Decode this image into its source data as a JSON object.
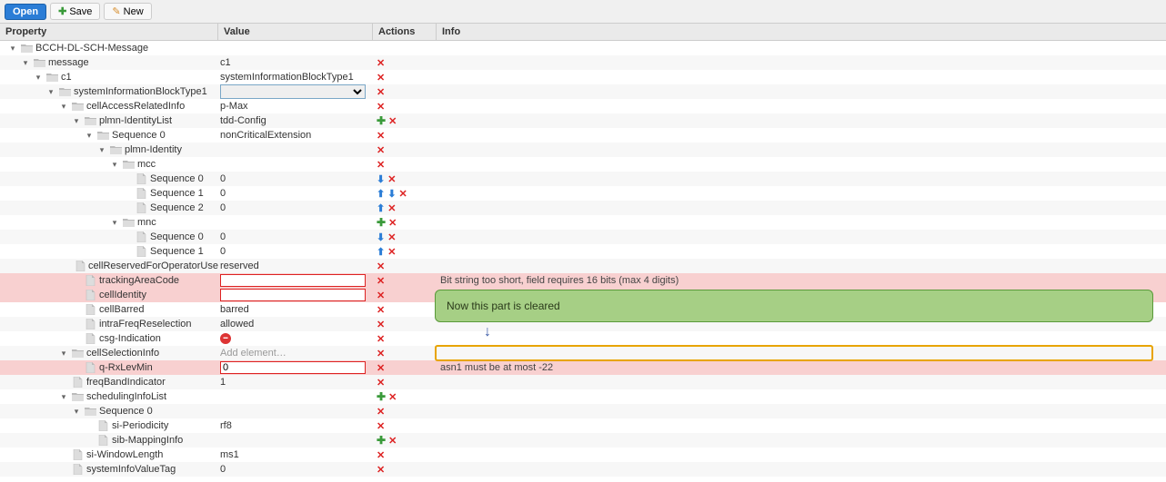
{
  "toolbar": {
    "open": "Open",
    "save": "Save",
    "new": "New"
  },
  "columns": {
    "property": "Property",
    "value": "Value",
    "actions": "Actions",
    "info": "Info"
  },
  "callout": {
    "text": "Now this part is cleared"
  },
  "rows": [
    {
      "depth": 0,
      "toggle": "▾",
      "icon": "folder",
      "label": "BCCH-DL-SCH-Message",
      "value": "",
      "actions": [],
      "info": ""
    },
    {
      "depth": 1,
      "toggle": "▾",
      "icon": "folder",
      "label": "message",
      "value": "c1",
      "actions": [
        "x"
      ],
      "info": ""
    },
    {
      "depth": 2,
      "toggle": "▾",
      "icon": "folder",
      "label": "c1",
      "value": "systemInformationBlockType1",
      "actions": [
        "x"
      ],
      "info": ""
    },
    {
      "depth": 3,
      "toggle": "▾",
      "icon": "folder",
      "label": "systemInformationBlockType1",
      "value": "",
      "valueSelect": true,
      "actions": [
        "x"
      ],
      "info": ""
    },
    {
      "depth": 4,
      "toggle": "▾",
      "icon": "folder",
      "label": "cellAccessRelatedInfo",
      "value": "p-Max",
      "actions": [
        "x"
      ],
      "info": ""
    },
    {
      "depth": 5,
      "toggle": "▾",
      "icon": "folder",
      "label": "plmn-IdentityList",
      "value": "tdd-Config",
      "actions": [
        "plus",
        "x"
      ],
      "info": ""
    },
    {
      "depth": 6,
      "toggle": "▾",
      "icon": "folder",
      "label": "Sequence 0",
      "value": "nonCriticalExtension",
      "actions": [
        "x"
      ],
      "info": ""
    },
    {
      "depth": 7,
      "toggle": "▾",
      "icon": "folder",
      "label": "plmn-Identity",
      "value": "",
      "actions": [
        "x"
      ],
      "info": ""
    },
    {
      "depth": 8,
      "toggle": "▾",
      "icon": "folder",
      "label": "mcc",
      "value": "",
      "actions": [
        "x"
      ],
      "info": ""
    },
    {
      "depth": 9,
      "toggle": "",
      "icon": "leaf",
      "label": "Sequence 0",
      "value": "0",
      "actions": [
        "down",
        "x"
      ],
      "info": ""
    },
    {
      "depth": 9,
      "toggle": "",
      "icon": "leaf",
      "label": "Sequence 1",
      "value": "0",
      "actions": [
        "up",
        "down",
        "x"
      ],
      "info": ""
    },
    {
      "depth": 9,
      "toggle": "",
      "icon": "leaf",
      "label": "Sequence 2",
      "value": "0",
      "actions": [
        "up",
        "x"
      ],
      "info": ""
    },
    {
      "depth": 8,
      "toggle": "▾",
      "icon": "folder",
      "label": "mnc",
      "value": "",
      "actions": [
        "plus",
        "x"
      ],
      "info": ""
    },
    {
      "depth": 9,
      "toggle": "",
      "icon": "leaf",
      "label": "Sequence 0",
      "value": "0",
      "actions": [
        "down",
        "x"
      ],
      "info": ""
    },
    {
      "depth": 9,
      "toggle": "",
      "icon": "leaf",
      "label": "Sequence 1",
      "value": "0",
      "actions": [
        "up",
        "x"
      ],
      "info": ""
    },
    {
      "depth": 7,
      "toggle": "",
      "icon": "leaf",
      "label": "cellReservedForOperatorUse",
      "value": "reserved",
      "actions": [
        "x"
      ],
      "info": ""
    },
    {
      "depth": 5,
      "toggle": "",
      "icon": "leaf",
      "label": "trackingAreaCode",
      "value": "",
      "valueInput": true,
      "actions": [
        "x"
      ],
      "info": "Bit string too short, field requires 16 bits (max 4 digits)",
      "err": true
    },
    {
      "depth": 5,
      "toggle": "",
      "icon": "leaf",
      "label": "cellIdentity",
      "value": "",
      "valueInput": true,
      "actions": [
        "x"
      ],
      "info": "",
      "err": true
    },
    {
      "depth": 5,
      "toggle": "",
      "icon": "leaf",
      "label": "cellBarred",
      "value": "barred",
      "actions": [
        "x"
      ],
      "info": ""
    },
    {
      "depth": 5,
      "toggle": "",
      "icon": "leaf",
      "label": "intraFreqReselection",
      "value": "allowed",
      "actions": [
        "x"
      ],
      "info": ""
    },
    {
      "depth": 5,
      "toggle": "",
      "icon": "leaf",
      "label": "csg-Indication",
      "value": "",
      "forbid": true,
      "actions": [
        "x"
      ],
      "info": ""
    },
    {
      "depth": 4,
      "toggle": "▾",
      "icon": "folder",
      "label": "cellSelectionInfo",
      "value": "Add element…",
      "placeholder": true,
      "actions": [
        "x"
      ],
      "info": ""
    },
    {
      "depth": 5,
      "toggle": "",
      "icon": "leaf",
      "label": "q-RxLevMin",
      "value": "0",
      "valueInput": true,
      "actions": [
        "x"
      ],
      "info": "asn1 must be at most -22",
      "err": true
    },
    {
      "depth": 4,
      "toggle": "",
      "icon": "leaf",
      "label": "freqBandIndicator",
      "value": "1",
      "actions": [
        "x"
      ],
      "info": ""
    },
    {
      "depth": 4,
      "toggle": "▾",
      "icon": "folder",
      "label": "schedulingInfoList",
      "value": "",
      "actions": [
        "plus",
        "x"
      ],
      "info": ""
    },
    {
      "depth": 5,
      "toggle": "▾",
      "icon": "folder",
      "label": "Sequence 0",
      "value": "",
      "actions": [
        "x"
      ],
      "info": ""
    },
    {
      "depth": 6,
      "toggle": "",
      "icon": "leaf",
      "label": "si-Periodicity",
      "value": "rf8",
      "actions": [
        "x"
      ],
      "info": ""
    },
    {
      "depth": 6,
      "toggle": "",
      "icon": "leaf",
      "label": "sib-MappingInfo",
      "value": "",
      "actions": [
        "plus",
        "x"
      ],
      "info": ""
    },
    {
      "depth": 4,
      "toggle": "",
      "icon": "leaf",
      "label": "si-WindowLength",
      "value": "ms1",
      "actions": [
        "x"
      ],
      "info": ""
    },
    {
      "depth": 4,
      "toggle": "",
      "icon": "leaf",
      "label": "systemInfoValueTag",
      "value": "0",
      "actions": [
        "x"
      ],
      "info": ""
    }
  ]
}
